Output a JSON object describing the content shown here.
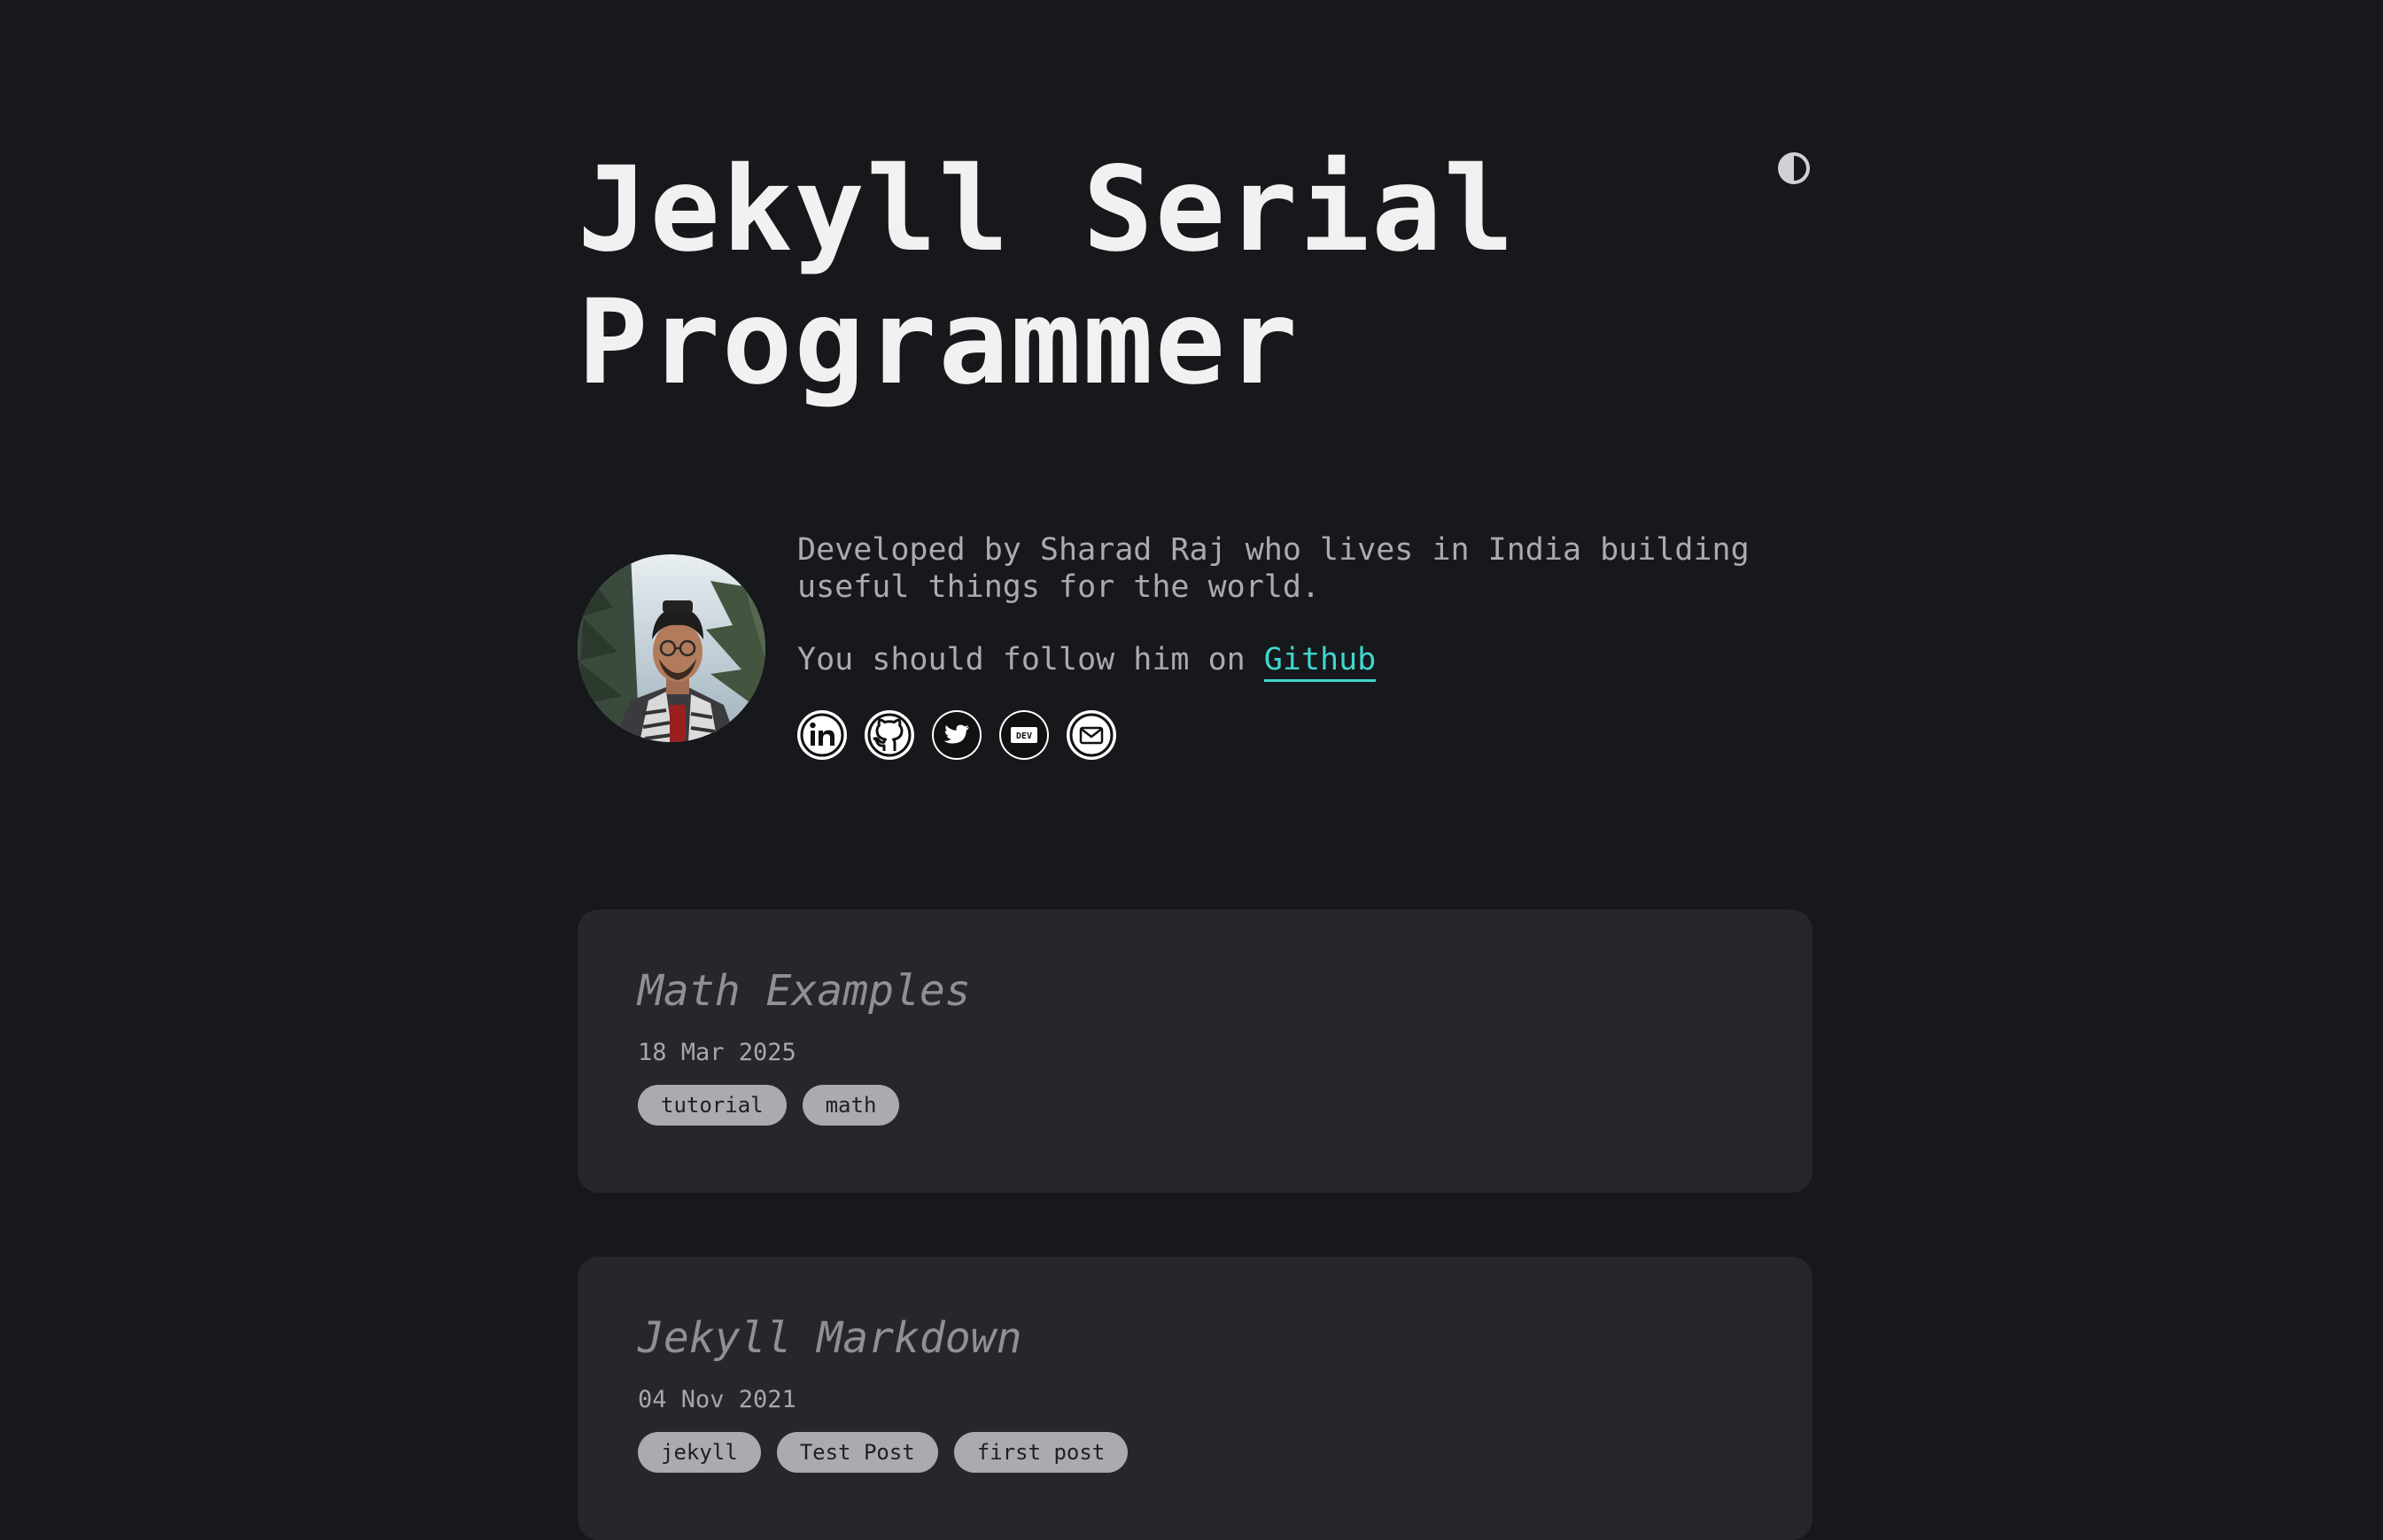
{
  "site": {
    "title": "Jekyll Serial Programmer"
  },
  "profile": {
    "bio": "Developed by Sharad Raj who lives in India building useful things for the world.",
    "follow_text": "You should follow him on ",
    "follow_link_label": "Github",
    "avatar_alt": "avatar"
  },
  "social_links": [
    {
      "icon": "linkedin-icon"
    },
    {
      "icon": "github-icon"
    },
    {
      "icon": "twitter-icon"
    },
    {
      "icon": "dev-icon",
      "label": "DEV"
    },
    {
      "icon": "mail-icon"
    }
  ],
  "posts": [
    {
      "title": "Math Examples",
      "date": "18 Mar 2025",
      "tags": [
        "tutorial",
        "math"
      ]
    },
    {
      "title": "Jekyll Markdown",
      "date": "04 Nov 2021",
      "tags": [
        "jekyll",
        "Test Post",
        "first post"
      ]
    }
  ],
  "colors": {
    "background": "#17181b",
    "card": "#25272c",
    "accent_link": "#3fd6cf",
    "tag_bg": "#a9abb1"
  }
}
